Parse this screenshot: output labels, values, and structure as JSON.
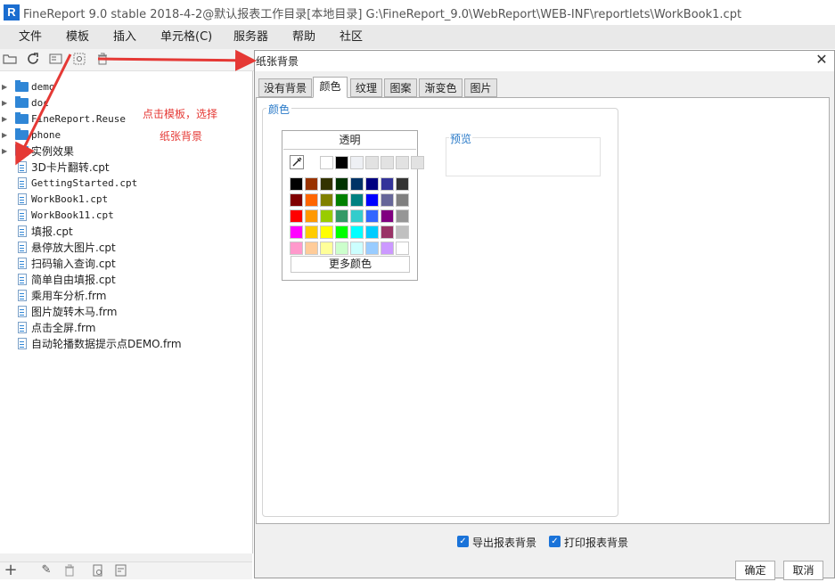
{
  "app": {
    "logo_letter": "R",
    "title": "FineReport 9.0 stable 2018-4-2@默认报表工作目录[本地目录]     G:\\FineReport_9.0\\WebReport\\WEB-INF\\reportlets\\WorkBook1.cpt"
  },
  "menu": {
    "items": [
      "文件",
      "模板",
      "插入",
      "单元格(C)",
      "服务器",
      "帮助",
      "社区"
    ]
  },
  "tree": {
    "items": [
      {
        "label": "demo",
        "type": "folder"
      },
      {
        "label": "doc",
        "type": "folder"
      },
      {
        "label": "FineReport.Reuse",
        "type": "folder"
      },
      {
        "label": "phone",
        "type": "folder"
      },
      {
        "label": "实例效果",
        "type": "folder"
      },
      {
        "label": "3D卡片翻转.cpt",
        "type": "file"
      },
      {
        "label": "GettingStarted.cpt",
        "type": "file"
      },
      {
        "label": "WorkBook1.cpt",
        "type": "file"
      },
      {
        "label": "WorkBook11.cpt",
        "type": "file"
      },
      {
        "label": "填报.cpt",
        "type": "file"
      },
      {
        "label": "悬停放大图片.cpt",
        "type": "file"
      },
      {
        "label": "扫码输入查询.cpt",
        "type": "file"
      },
      {
        "label": "简单自由填报.cpt",
        "type": "file"
      },
      {
        "label": "乘用车分析.frm",
        "type": "file"
      },
      {
        "label": "图片旋转木马.frm",
        "type": "file"
      },
      {
        "label": "点击全屏.frm",
        "type": "file"
      },
      {
        "label": "自动轮播数据提示点DEMO.frm",
        "type": "file"
      }
    ]
  },
  "annotation": {
    "line1": "点击模板，选择",
    "line2": "纸张背景",
    "color": "#e53935"
  },
  "dialog": {
    "title": "纸张背景",
    "close_glyph": "✕",
    "tabs": [
      "没有背景",
      "颜色",
      "纹理",
      "图案",
      "渐变色",
      "图片"
    ],
    "active_tab": "颜色",
    "color_group_title": "颜色",
    "palette": {
      "transparent_label": "透明",
      "recent": [
        "#ffffff",
        "#000000",
        "#eef0f4",
        "#e2e2e2",
        "#e2e2e2",
        "#e2e2e2",
        "#e2e2e2"
      ],
      "grid": [
        [
          "#000000",
          "#993300",
          "#333300",
          "#003300",
          "#003366",
          "#000080",
          "#333399",
          "#333333"
        ],
        [
          "#800000",
          "#ff6600",
          "#808000",
          "#008000",
          "#008080",
          "#0000ff",
          "#666699",
          "#808080"
        ],
        [
          "#ff0000",
          "#ff9900",
          "#99cc00",
          "#339966",
          "#33cccc",
          "#3366ff",
          "#800080",
          "#969696"
        ],
        [
          "#ff00ff",
          "#ffcc00",
          "#ffff00",
          "#00ff00",
          "#00ffff",
          "#00ccff",
          "#993366",
          "#c0c0c0"
        ],
        [
          "#ff99cc",
          "#ffcc99",
          "#ffff99",
          "#ccffcc",
          "#ccffff",
          "#99ccff",
          "#cc99ff",
          "#ffffff"
        ]
      ],
      "more_colors_label": "更多颜色"
    },
    "preview_title": "预览",
    "checkboxes": [
      {
        "label": "导出报表背景",
        "checked": true
      },
      {
        "label": "打印报表背景",
        "checked": true
      }
    ],
    "ok_label": "确定",
    "cancel_label": "取消"
  },
  "colors": {
    "accent": "#1a73d9",
    "folder": "#2f86d6"
  }
}
